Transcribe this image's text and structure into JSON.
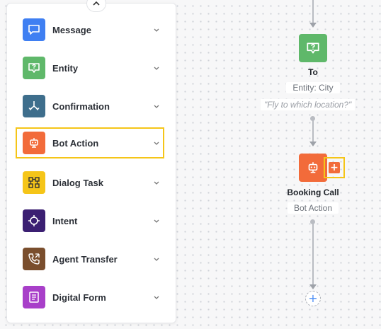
{
  "palette": {
    "items": [
      {
        "label": "Message",
        "icon": "message-icon",
        "color": "#3f7ff2"
      },
      {
        "label": "Entity",
        "icon": "entity-icon",
        "color": "#5fb86a"
      },
      {
        "label": "Confirmation",
        "icon": "confirmation-icon",
        "color": "#3e6e8c"
      },
      {
        "label": "Bot Action",
        "icon": "bot-action-icon",
        "color": "#f26b3a",
        "selected": true
      },
      {
        "label": "Dialog Task",
        "icon": "dialog-task-icon",
        "color": "#f5c518"
      },
      {
        "label": "Intent",
        "icon": "intent-icon",
        "color": "#3b1f72"
      },
      {
        "label": "Agent Transfer",
        "icon": "agent-transfer-icon",
        "color": "#7a4e2d"
      },
      {
        "label": "Digital Form",
        "icon": "digital-form-icon",
        "color": "#a83fc9"
      }
    ]
  },
  "canvas": {
    "entity_node": {
      "title": "To",
      "subtitle": "Entity: City",
      "prompt": "\"Fly to which location?\"",
      "color": "#5fb86a"
    },
    "bot_action_node": {
      "title": "Booking Call",
      "subtitle": "Bot Action",
      "color": "#f26b3a",
      "add_label": "+"
    },
    "end_add_label": "+"
  }
}
